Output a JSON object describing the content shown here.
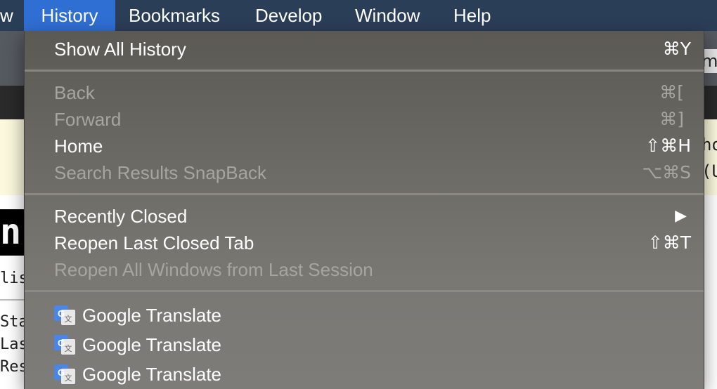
{
  "menubar": {
    "items": [
      {
        "label": "w",
        "active": false
      },
      {
        "label": "History",
        "active": true
      },
      {
        "label": "Bookmarks",
        "active": false
      },
      {
        "label": "Develop",
        "active": false
      },
      {
        "label": "Window",
        "active": false
      },
      {
        "label": "Help",
        "active": false
      }
    ]
  },
  "background": {
    "toolbar_button_text": "m",
    "snippet_right_1": "ho",
    "snippet_right_2": "(U",
    "snippet_left_block": "n",
    "snippet_left_list": "lis",
    "snippet_left_a": "Sta",
    "snippet_left_b": "Las",
    "snippet_left_c": "Res"
  },
  "history_menu": {
    "show_all": {
      "label": "Show All History",
      "shortcut": "⌘Y"
    },
    "back": {
      "label": "Back",
      "shortcut": "⌘["
    },
    "forward": {
      "label": "Forward",
      "shortcut": "⌘]"
    },
    "home": {
      "label": "Home",
      "shortcut": "⇧⌘H"
    },
    "snapback": {
      "label": "Search Results SnapBack",
      "shortcut": "⌥⌘S"
    },
    "recently_closed": {
      "label": "Recently Closed",
      "shortcut": "▶"
    },
    "reopen_tab": {
      "label": "Reopen Last Closed Tab",
      "shortcut": "⇧⌘T"
    },
    "reopen_windows": {
      "label": "Reopen All Windows from Last Session"
    },
    "history_items": [
      {
        "label": "Google Translate",
        "icon": "google-translate-icon"
      },
      {
        "label": "Google Translate",
        "icon": "google-translate-icon"
      },
      {
        "label": "Google Translate",
        "icon": "google-translate-icon"
      }
    ]
  },
  "colors": {
    "menubar_bg": "#2b3e58",
    "active_menu": "#2f6fd3",
    "menu_text_enabled": "#ffffff",
    "menu_text_disabled": "#a7a5a0"
  }
}
